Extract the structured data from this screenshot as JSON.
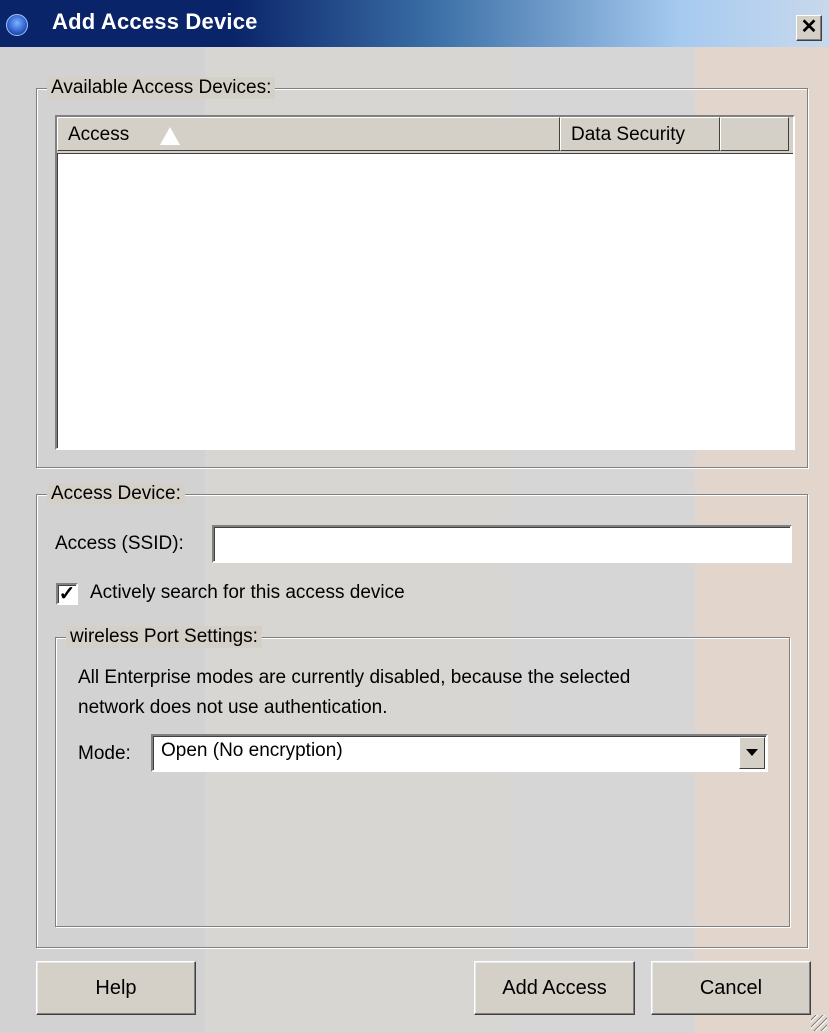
{
  "window": {
    "title": "Add Access Device",
    "close_glyph": "✕"
  },
  "available_group": {
    "label": "Available Access Devices:",
    "columns": [
      {
        "label": "Access",
        "sorted": "ascending"
      },
      {
        "label": "Data Security"
      },
      {
        "label": ""
      }
    ],
    "rows": []
  },
  "device_group": {
    "label": "Access Device:",
    "ssid_label": "Access (SSID):",
    "ssid_value": "",
    "active_search_label": "Actively search for this access device",
    "active_search_checked": true,
    "checkmark": "✓"
  },
  "wireless_group": {
    "label": "wireless Port Settings:",
    "note_line1": "All Enterprise modes are currently disabled, because the selected",
    "note_line2": "network does not use authentication.",
    "mode_label": "Mode:",
    "mode_value": "Open (No encryption)"
  },
  "buttons": {
    "help": "Help",
    "add_access": "Add Access",
    "cancel": "Cancel"
  },
  "icons": {
    "title": "app-globe-icon",
    "close": "close-icon",
    "sort": "sort-ascending-icon",
    "dropdown": "chevron-down-icon",
    "grip": "resize-grip-icon"
  },
  "colors": {
    "title_gradient_start": "#0a246a",
    "title_gradient_end": "#c8d8ec",
    "dialog_face": "#d4d0c8"
  }
}
